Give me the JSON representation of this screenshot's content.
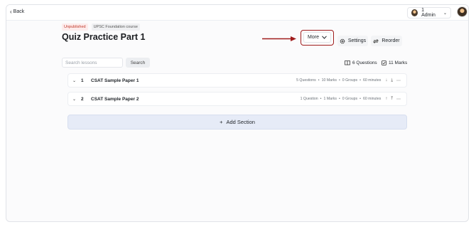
{
  "nav": {
    "back_label": "Back"
  },
  "user": {
    "name": "1 Admin"
  },
  "course": {
    "status_badge": "Unpublished",
    "course_badge": "UPSC Foundation course",
    "title": "Quiz Practice Part 1"
  },
  "toolbar": {
    "more_label": "More",
    "settings_label": "Settings",
    "reorder_label": "Reorder"
  },
  "search": {
    "placeholder": "Search lessons",
    "button_label": "Search"
  },
  "stats": {
    "questions": "6 Questions",
    "marks": "11 Marks"
  },
  "sections": [
    {
      "index": "1",
      "name": "CSAT Sample Paper 1",
      "questions": "5 Questions",
      "marks": "10 Marks",
      "groups": "0 Groups",
      "duration": "60 minutes"
    },
    {
      "index": "2",
      "name": "CSAT Sample Paper 2",
      "questions": "1 Question",
      "marks": "1 Marks",
      "groups": "0 Groups",
      "duration": "60 minutes"
    }
  ],
  "add_section_label": "Add Section",
  "colors": {
    "highlight": "#a01c1c",
    "add_section_bg": "#e6ebf7",
    "unpublished": "#c0392b"
  }
}
